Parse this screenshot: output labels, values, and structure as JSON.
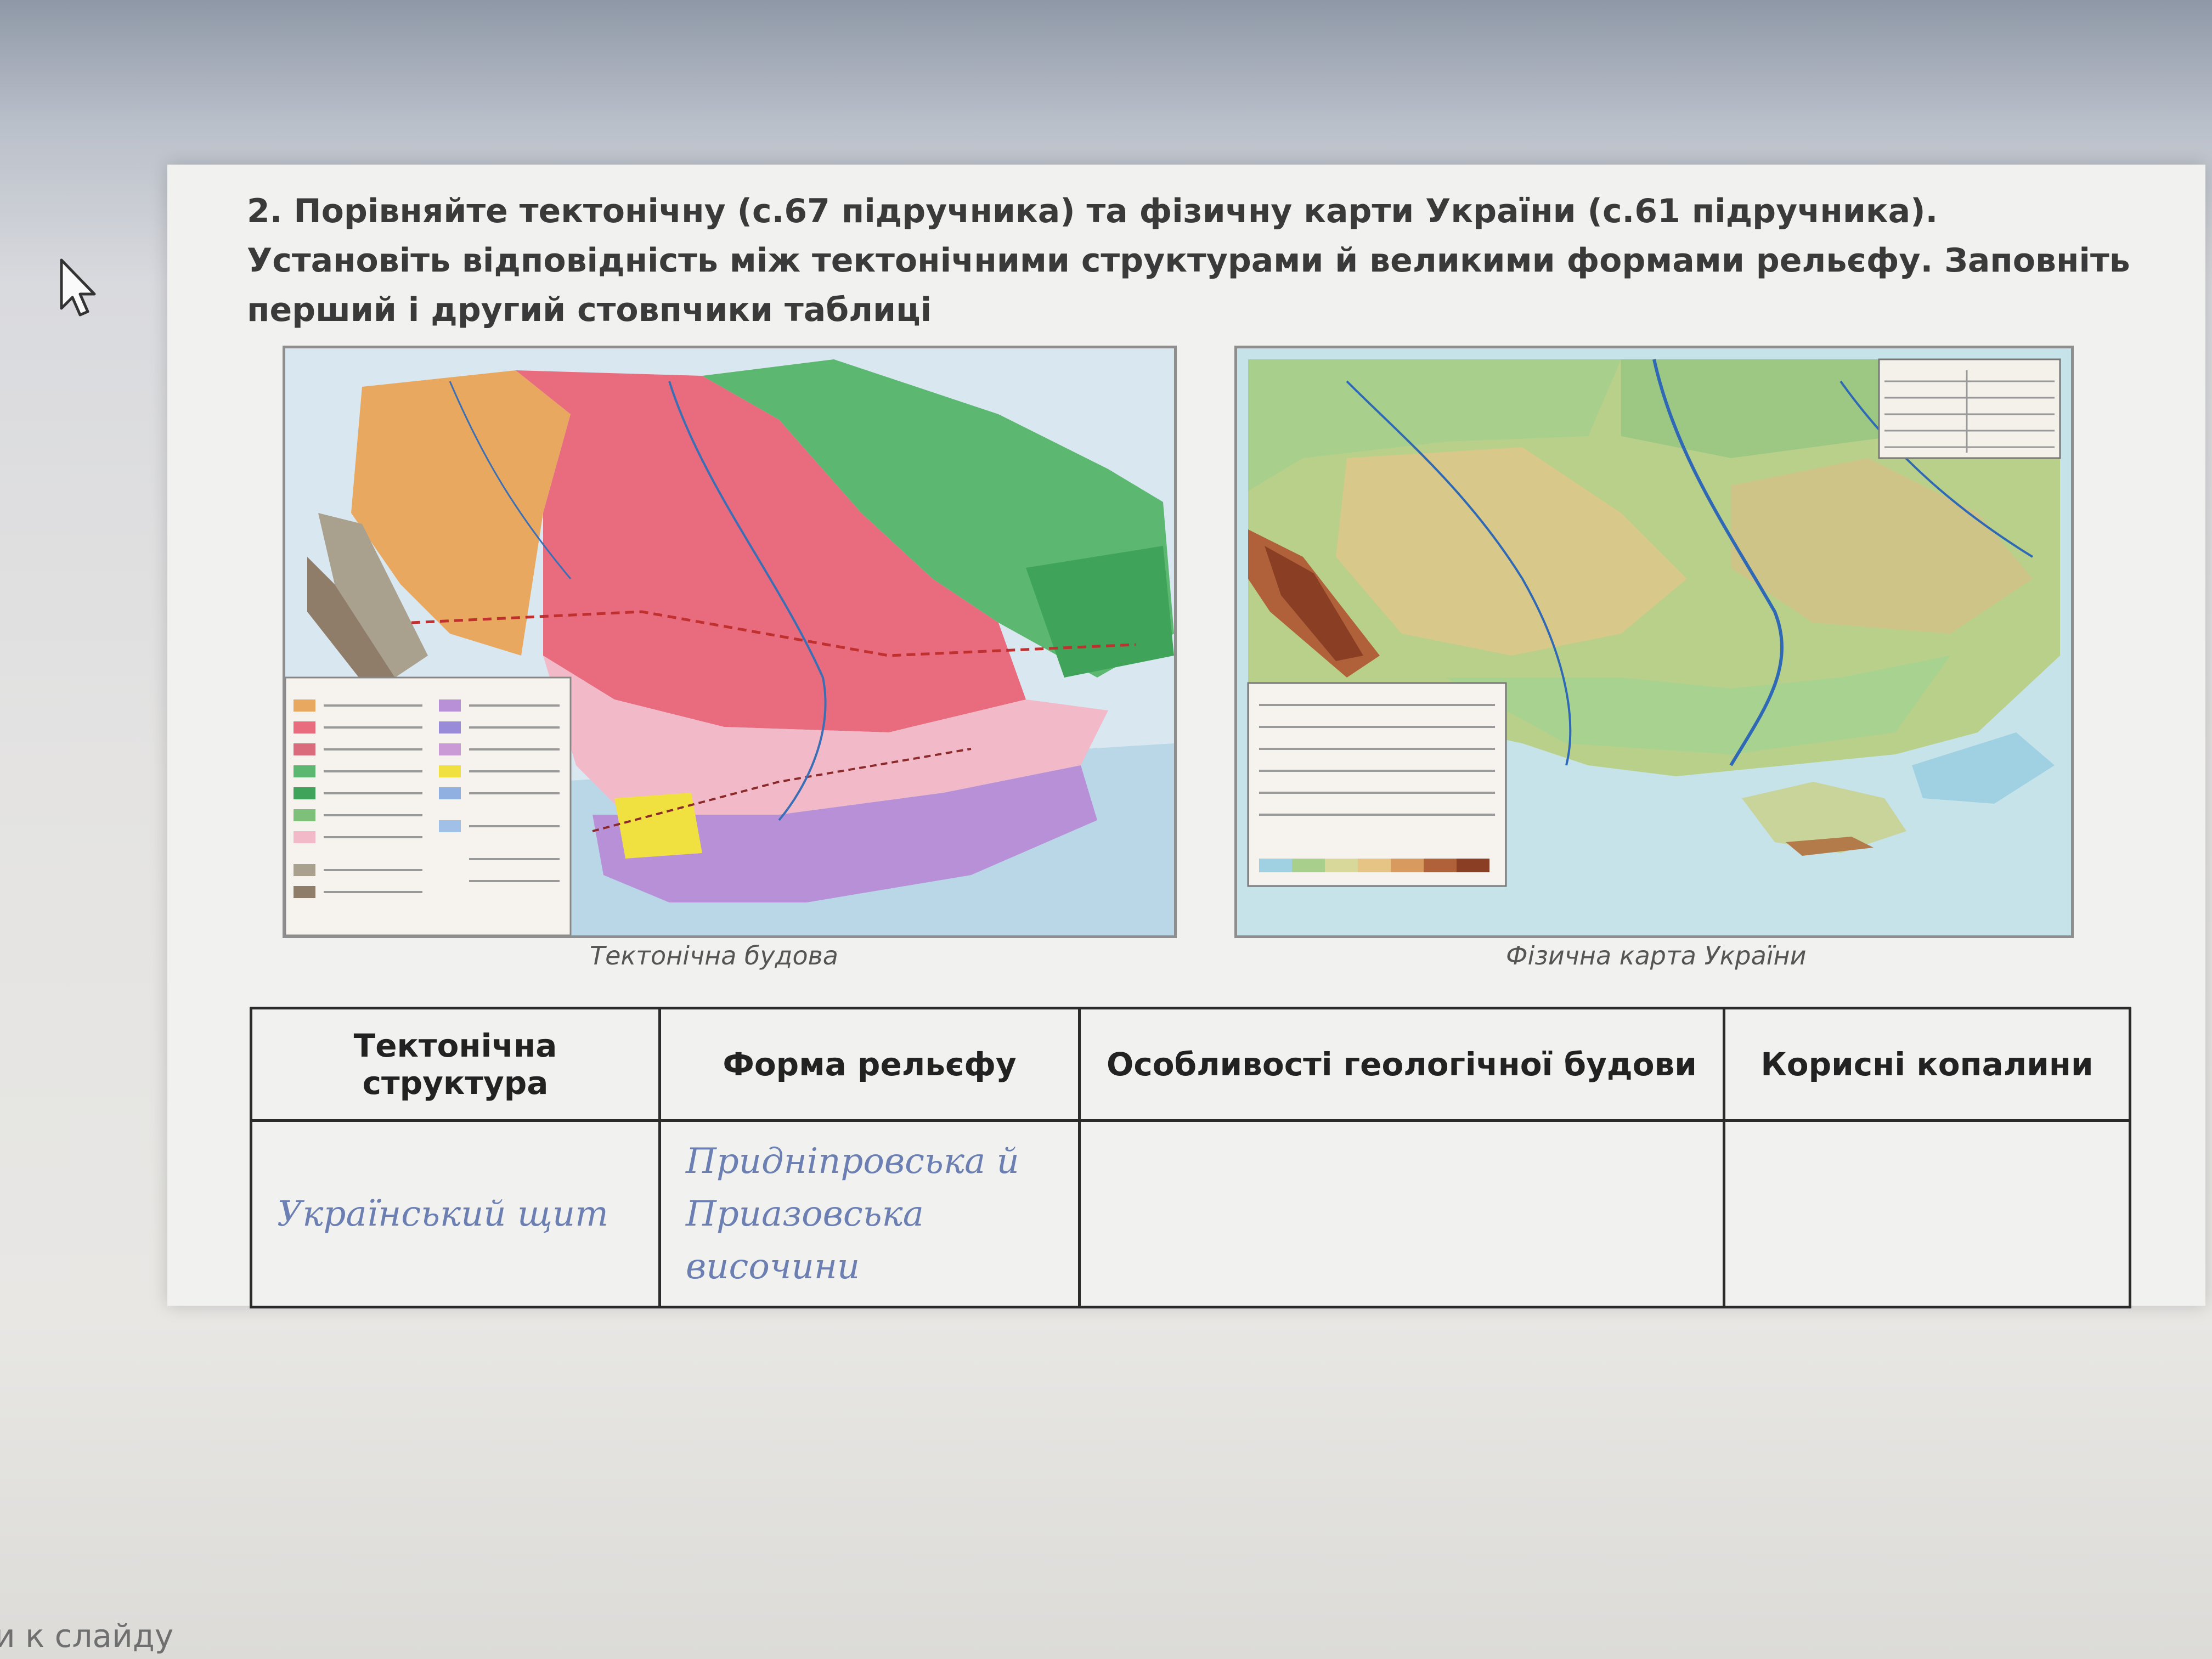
{
  "task": {
    "text": "2. Порівняйте тектонічну (с.67 підручника) та фізичну карти України (с.61 підручника). Установіть відповідність між тектонічними структурами й великими формами рельєфу. Заповніть перший і другий стовпчики таблиці"
  },
  "maps": {
    "tectonic_caption": "Тектонічна будова",
    "physical_caption": "Фізична карта України"
  },
  "table": {
    "headers": [
      "Тектонічна структура",
      "Форма рельєфу",
      "Особливості геологічної будови",
      "Корисні копалини"
    ],
    "rows": [
      {
        "structure": "Український щит",
        "relief": "Придніпровська й Приазовська височини",
        "geology": "",
        "minerals": ""
      }
    ]
  },
  "bottom_note": "и к слайду"
}
